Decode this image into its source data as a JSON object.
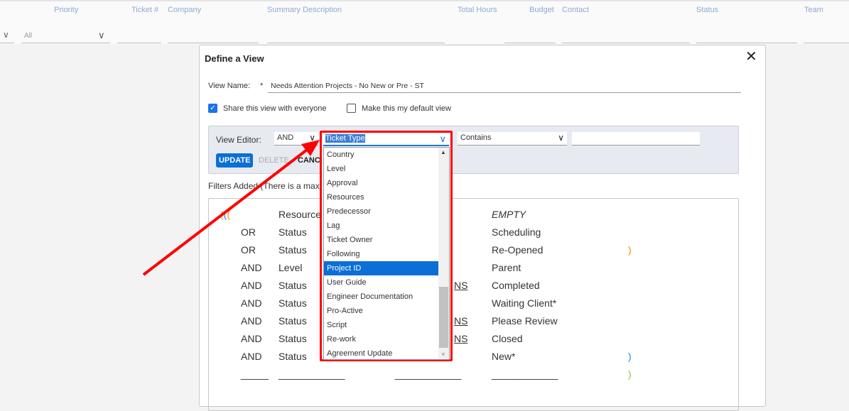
{
  "grid": {
    "columns": [
      "Priority",
      "Ticket #",
      "Company",
      "Summary Description",
      "Total Hours",
      "Budget",
      "Contact",
      "Status",
      "Team"
    ],
    "priority_filter": "All"
  },
  "dialog": {
    "title": "Define a View",
    "view_name_label": "View Name:",
    "required_mark": "*",
    "view_name_value": "Needs Attention Projects - No New or Pre - ST",
    "share_label": "Share this view with everyone",
    "share_checked": true,
    "default_label": "Make this my default view",
    "default_checked": false,
    "editor": {
      "label": "View Editor:",
      "conjunction": "AND",
      "field": "Ticket Type",
      "operator": "Contains",
      "value": "",
      "update": "UPDATE",
      "delete": "DELETE",
      "cancel": "CANCEL"
    },
    "filters_label": "Filters Added (There is a maximum",
    "filters": [
      {
        "open": "(((",
        "conj": "",
        "field": "Resources",
        "op": "",
        "value": "EMPTY",
        "close": ""
      },
      {
        "open": "",
        "conj": "OR",
        "field": "Status",
        "op": "",
        "value": "Scheduling",
        "close": ""
      },
      {
        "open": "",
        "conj": "OR",
        "field": "Status",
        "op": "",
        "value": "Re-Opened",
        "close": ")"
      },
      {
        "open": "",
        "conj": "AND",
        "field": "Level",
        "op": "",
        "value": "Parent",
        "close": ""
      },
      {
        "open": "",
        "conj": "AND",
        "field": "Status",
        "op": "NS",
        "value": "Completed",
        "close": ""
      },
      {
        "open": "",
        "conj": "AND",
        "field": "Status",
        "op": "",
        "value": "Waiting Client*",
        "close": ""
      },
      {
        "open": "",
        "conj": "AND",
        "field": "Status",
        "op": "NS",
        "value": "Please Review",
        "close": ""
      },
      {
        "open": "",
        "conj": "AND",
        "field": "Status",
        "op": "NS",
        "value": "Closed",
        "close": ""
      },
      {
        "open": "",
        "conj": "AND",
        "field": "Status",
        "op": "",
        "value": "New*",
        "close": ")"
      },
      {
        "open": "",
        "conj": "_____",
        "field": "____________",
        "op": "____________",
        "value": "____________",
        "close": ")"
      }
    ],
    "field_options": [
      "Country",
      "Level",
      "Approval",
      "Resources",
      "Predecessor",
      "Lag",
      "Ticket Owner",
      "Following",
      "Project ID",
      "User Guide",
      "Engineer Documentation",
      "Pro-Active",
      "Script",
      "Re-work",
      "Agreement Update"
    ],
    "highlighted_option": "Project ID"
  },
  "colors": {
    "accent": "#0a6fd6",
    "annotation": "#ff0000",
    "paren_green": "#8bc34a",
    "paren_blue": "#1e88e5",
    "paren_orange": "#fb8c00"
  }
}
